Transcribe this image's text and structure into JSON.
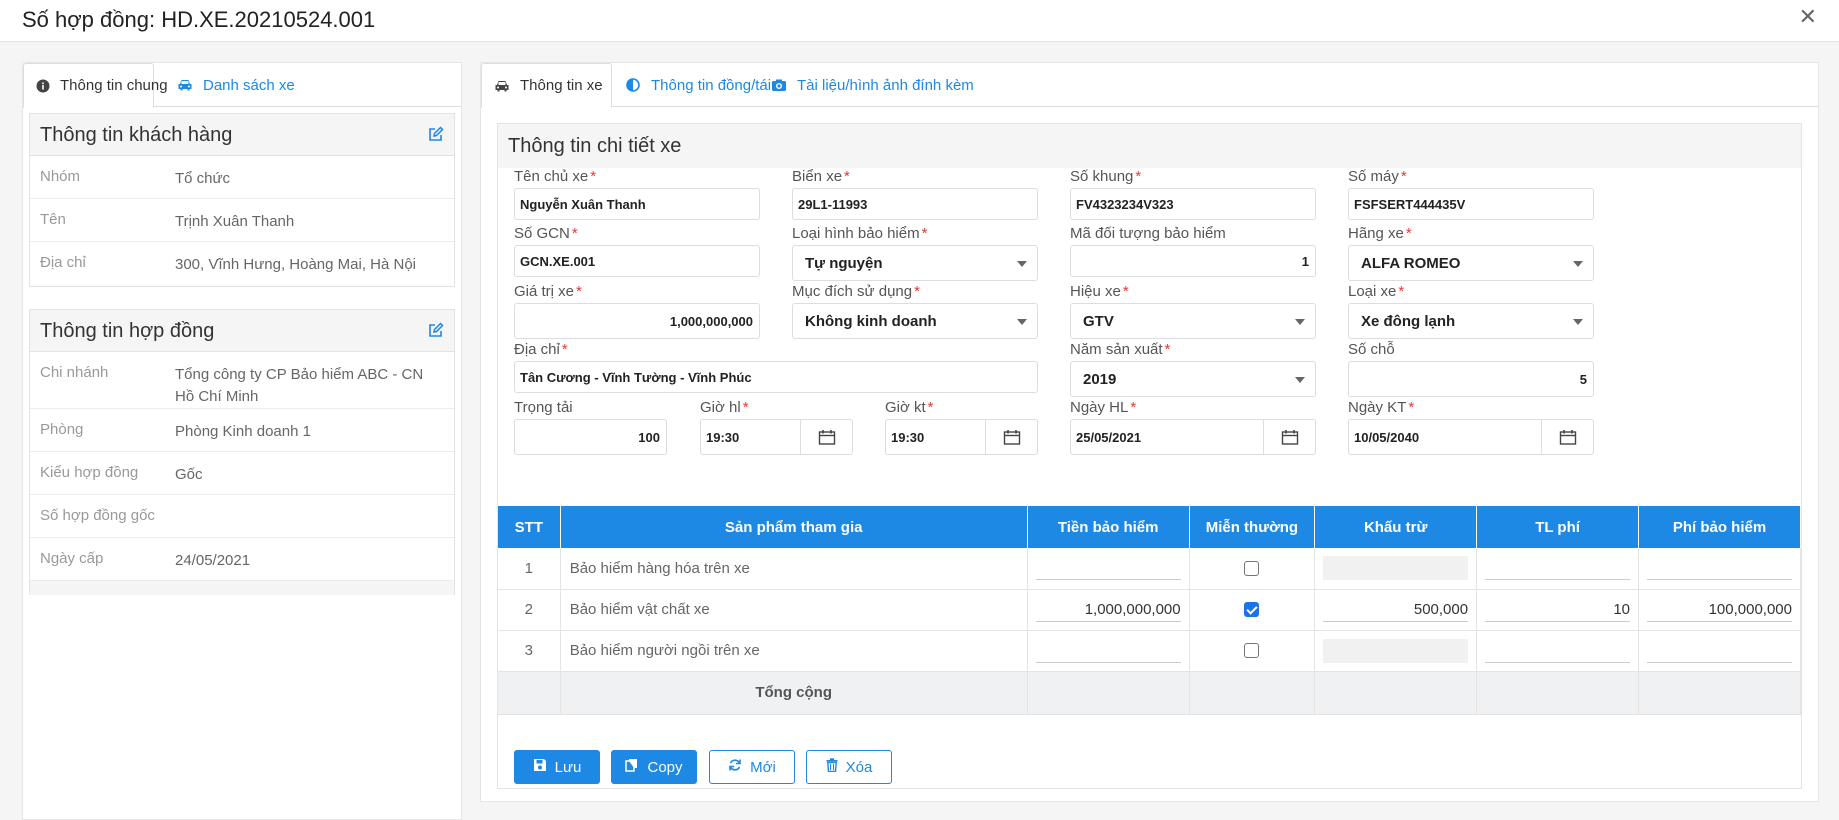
{
  "header": {
    "title": "Số hợp đồng: HD.XE.20210524.001"
  },
  "left": {
    "tabs": [
      {
        "label": "Thông tin chung"
      },
      {
        "label": "Danh sách xe"
      }
    ],
    "customer": {
      "title": "Thông tin khách hàng",
      "rows": [
        {
          "label": "Nhóm",
          "value": "Tổ chức"
        },
        {
          "label": "Tên",
          "value": "Trịnh Xuân Thanh"
        },
        {
          "label": "Địa chỉ",
          "value": "300, Vĩnh Hưng, Hoàng Mai, Hà Nội"
        }
      ]
    },
    "contract": {
      "title": "Thông tin hợp đồng",
      "rows": [
        {
          "label": "Chi nhánh",
          "value": "Tổng công ty CP Bảo hiểm ABC - CN Hồ Chí Minh"
        },
        {
          "label": "Phòng",
          "value": "Phòng Kinh doanh 1"
        },
        {
          "label": "Kiểu hợp đồng",
          "value": "Gốc"
        },
        {
          "label": "Số hợp đồng gốc",
          "value": ""
        },
        {
          "label": "Ngày cấp",
          "value": "24/05/2021"
        }
      ]
    }
  },
  "right": {
    "tabs": [
      {
        "label": "Thông tin xe"
      },
      {
        "label": "Thông tin đồng/tái"
      },
      {
        "label": "Tài liệu/hình ảnh đính kèm"
      }
    ],
    "section_title": "Thông tin chi tiết xe",
    "fields": {
      "owner": {
        "label": "Tên chủ xe",
        "value": "Nguyễn Xuân Thanh"
      },
      "plate": {
        "label": "Biển xe",
        "value": "29L1-11993"
      },
      "chassis": {
        "label": "Số khung",
        "value": "FV4323234V323"
      },
      "engine": {
        "label": "Số máy",
        "value": "FSFSERT444435V"
      },
      "gcn": {
        "label": "Số GCN",
        "value": "GCN.XE.001"
      },
      "ins_type": {
        "label": "Loại hình bảo hiểm",
        "value": "Tự nguyện"
      },
      "object_code": {
        "label": "Mã đối tượng bảo hiểm",
        "value": "1"
      },
      "brand": {
        "label": "Hãng xe",
        "value": "ALFA ROMEO"
      },
      "car_value": {
        "label": "Giá trị xe",
        "value": "1,000,000,000"
      },
      "purpose": {
        "label": "Mục đích sử dụng",
        "value": "Không kinh doanh"
      },
      "model": {
        "label": "Hiệu xe",
        "value": "GTV"
      },
      "car_type": {
        "label": "Loại xe",
        "value": "Xe đông lạnh"
      },
      "address": {
        "label": "Địa chỉ",
        "value": "Tân Cương - Vĩnh Tường - Vĩnh Phúc"
      },
      "year": {
        "label": "Năm sản xuất",
        "value": "2019"
      },
      "seats": {
        "label": "Số chỗ",
        "value": "5"
      },
      "load": {
        "label": "Trọng tải",
        "value": "100"
      },
      "time_start": {
        "label": "Giờ hl",
        "value": "19:30"
      },
      "time_end": {
        "label": "Giờ kt",
        "value": "19:30"
      },
      "date_start": {
        "label": "Ngày HL",
        "value": "25/05/2021"
      },
      "date_end": {
        "label": "Ngày KT",
        "value": "10/05/2040"
      }
    },
    "table": {
      "headers": [
        "STT",
        "Sản phẩm tham gia",
        "Tiền bảo hiểm",
        "Miễn thường",
        "Khấu trừ",
        "TL phí",
        "Phí bảo hiểm"
      ],
      "rows": [
        {
          "stt": "1",
          "product": "Bảo hiểm hàng hóa trên xe",
          "amount": "",
          "exempt": false,
          "deduct": "",
          "rate": "",
          "fee": ""
        },
        {
          "stt": "2",
          "product": "Bảo hiểm vật chất xe",
          "amount": "1,000,000,000",
          "exempt": true,
          "deduct": "500,000",
          "rate": "10",
          "fee": "100,000,000"
        },
        {
          "stt": "3",
          "product": "Bảo hiểm người ngồi trên xe",
          "amount": "",
          "exempt": false,
          "deduct": "",
          "rate": "",
          "fee": ""
        }
      ],
      "total_label": "Tổng cộng"
    },
    "buttons": {
      "save": "Lưu",
      "copy": "Copy",
      "new": "Mới",
      "delete": "Xóa"
    }
  },
  "colors": {
    "accent": "#1e88e5",
    "required": "#e53935"
  }
}
